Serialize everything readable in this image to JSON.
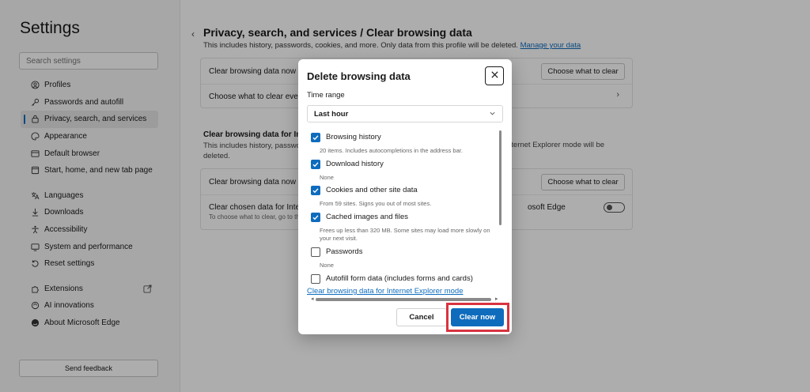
{
  "sidebar": {
    "title": "Settings",
    "search_placeholder": "Search settings",
    "items": [
      {
        "label": "Profiles",
        "icon": "profile-icon"
      },
      {
        "label": "Passwords and autofill",
        "icon": "key-icon"
      },
      {
        "label": "Privacy, search, and services",
        "icon": "lock-icon",
        "active": true
      },
      {
        "label": "Appearance",
        "icon": "palette-icon"
      },
      {
        "label": "Default browser",
        "icon": "browser-icon"
      },
      {
        "label": "Start, home, and new tab page",
        "icon": "home-icon"
      },
      {
        "label": "Languages",
        "icon": "language-icon"
      },
      {
        "label": "Downloads",
        "icon": "download-icon"
      },
      {
        "label": "Accessibility",
        "icon": "accessibility-icon"
      },
      {
        "label": "System and performance",
        "icon": "system-icon"
      },
      {
        "label": "Reset settings",
        "icon": "reset-icon"
      },
      {
        "label": "Extensions",
        "icon": "extensions-icon"
      },
      {
        "label": "AI innovations",
        "icon": "ai-icon"
      },
      {
        "label": "About Microsoft Edge",
        "icon": "edge-icon"
      }
    ],
    "feedback": "Send feedback"
  },
  "main": {
    "title": "Privacy, search, and services / Clear browsing data",
    "subtitle": "This includes history, passwords, cookies, and more. Only data from this profile will be deleted.",
    "manage_link": "Manage your data",
    "card1": {
      "row1": "Clear browsing data now",
      "row1_button": "Choose what to clear",
      "row2": "Choose what to clear every"
    },
    "section": {
      "title": "Clear browsing data for Intern",
      "sub_line1": "This includes history, passwo",
      "sub_line2": "deleted.",
      "sub_right": "nternet Explorer mode will be"
    },
    "card2": {
      "row1": "Clear browsing data now",
      "row1_button": "Choose what to clear",
      "row2": "Clear chosen data for Interr",
      "row2_note": "To choose what to clear, go to th",
      "row2_right": "osoft Edge"
    }
  },
  "dialog": {
    "title": "Delete browsing data",
    "time_range_label": "Time range",
    "time_range_value": "Last hour",
    "options": [
      {
        "label": "Browsing history",
        "desc": "20 items. Includes autocompletions in the address bar.",
        "checked": true
      },
      {
        "label": "Download history",
        "desc": "None",
        "checked": true
      },
      {
        "label": "Cookies and other site data",
        "desc": "From 59 sites. Signs you out of most sites.",
        "checked": true
      },
      {
        "label": "Cached images and files",
        "desc": "Frees up less than 320 MB. Some sites may load more slowly on your next visit.",
        "checked": true
      },
      {
        "label": "Passwords",
        "desc": "None",
        "checked": false
      },
      {
        "label": "Autofill form data (includes forms and cards)",
        "desc": "",
        "checked": false
      }
    ],
    "ie_link": "Clear browsing data for Internet Explorer mode",
    "cancel": "Cancel",
    "clear_now": "Clear now"
  },
  "colors": {
    "accent": "#0f6cbd",
    "highlight": "#d9333f"
  }
}
